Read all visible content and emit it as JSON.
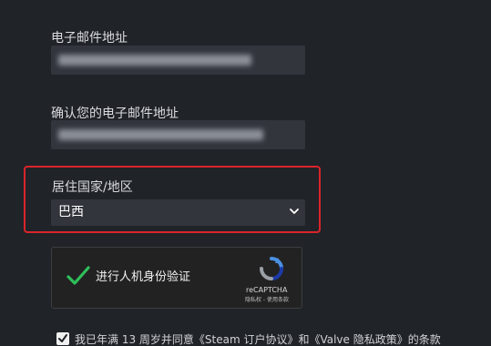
{
  "form": {
    "email_label": "电子邮件地址",
    "confirm_email_label": "确认您的电子邮件地址",
    "country_label": "居住国家/地区",
    "country_value": "巴西"
  },
  "captcha": {
    "label": "进行人机身份验证",
    "brand": "reCAPTCHA",
    "links": "隐私权 - 使用条款"
  },
  "agreement": {
    "text": "我已年满 13 周岁并同意《Steam 订户协议》和《Valve 隐私政策》的条款"
  },
  "colors": {
    "background": "#202328",
    "field": "#32353c",
    "highlight": "#d9242b",
    "check_green": "#2fbf5a"
  }
}
